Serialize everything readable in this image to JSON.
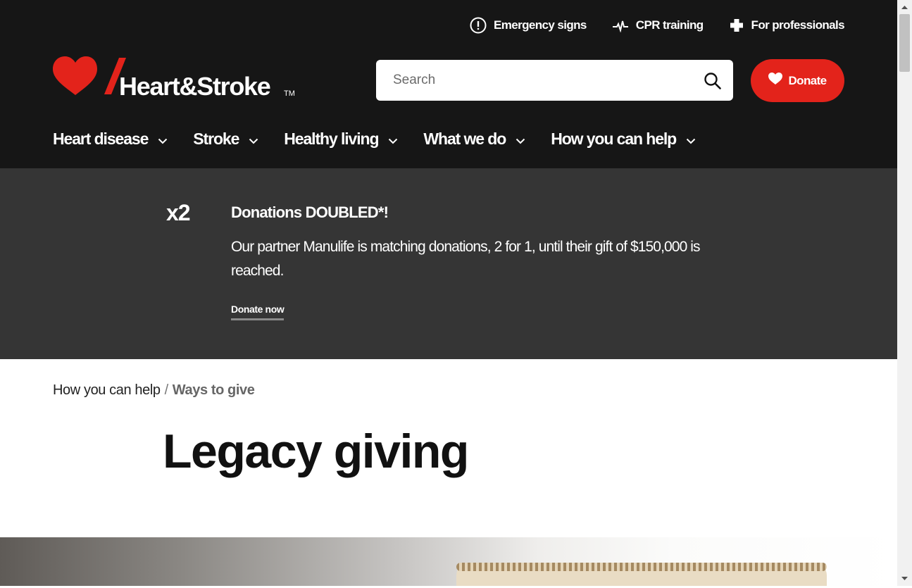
{
  "utility_nav": [
    {
      "label": "Emergency signs",
      "icon": "alert-circle-icon"
    },
    {
      "label": "CPR training",
      "icon": "heartbeat-icon"
    },
    {
      "label": "For professionals",
      "icon": "plus-cross-icon"
    }
  ],
  "logo": {
    "text": "Heart&Stroke",
    "tm": "TM",
    "color": "#e3231b"
  },
  "search": {
    "placeholder": "Search",
    "icon": "search-icon"
  },
  "donate_button": {
    "label": "Donate",
    "icon": "heart-icon",
    "color": "#e3231b"
  },
  "main_nav": [
    {
      "label": "Heart disease"
    },
    {
      "label": "Stroke"
    },
    {
      "label": "Healthy living"
    },
    {
      "label": "What we do"
    },
    {
      "label": "How you can help"
    }
  ],
  "promo": {
    "badge": "x2",
    "title": "Donations DOUBLED*!",
    "text": "Our partner Manulife is matching donations, 2 for 1, until their gift of $150,000 is reached.",
    "link": "Donate now"
  },
  "breadcrumb": {
    "parent": "How you can help",
    "separator": "/",
    "current": "Ways to give"
  },
  "page_title": "Legacy giving",
  "colors": {
    "header_bg": "#161616",
    "promo_bg": "#353535",
    "accent": "#e3231b"
  }
}
